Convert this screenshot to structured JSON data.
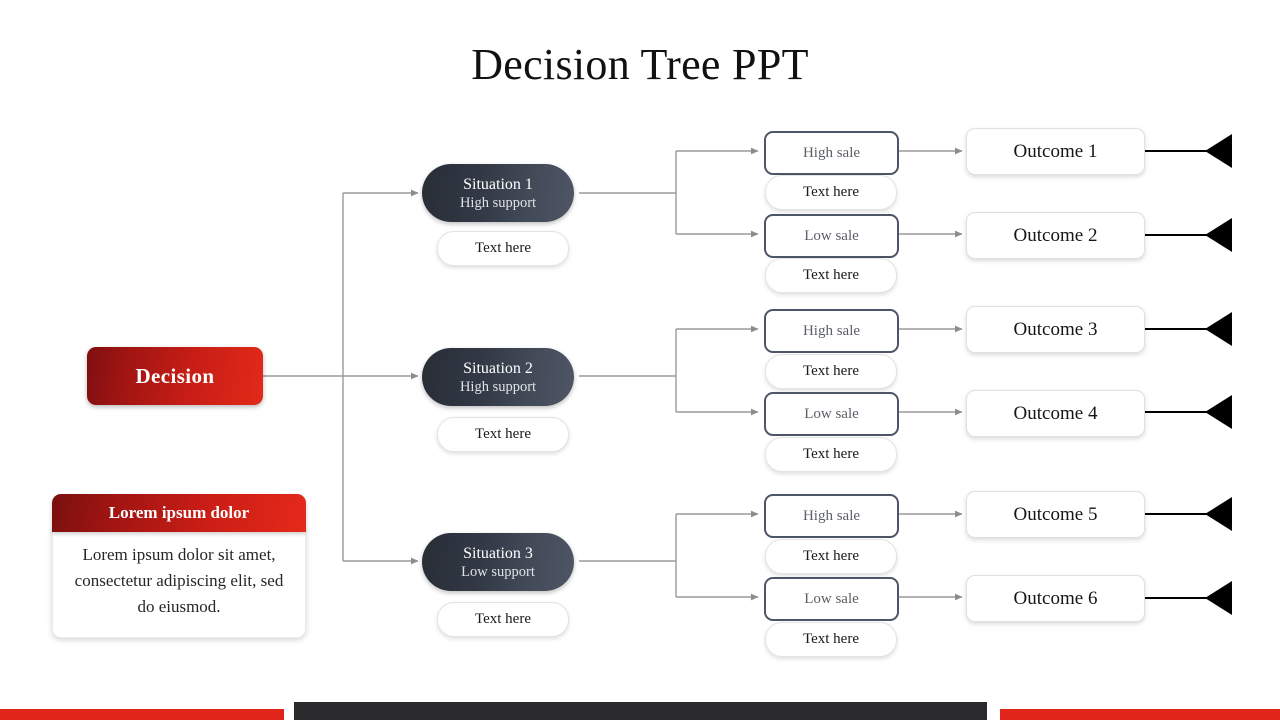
{
  "page": {
    "title": "Decision Tree PPT",
    "background": "#ffffff"
  },
  "colors": {
    "accent_red_dark": "#7e0f11",
    "accent_red_bright": "#e22a18",
    "node_slate_dark": "#282d36",
    "node_slate_light": "#4e5665",
    "bar_red": "#e2251a",
    "bar_dark": "#2a2a2c",
    "wire_gray": "#9a9a9a",
    "sale_border": "#4d5566",
    "arrow_black": "#000000"
  },
  "decision": {
    "label": "Decision"
  },
  "situations": [
    {
      "title": "Situation 1",
      "subtitle": "High support",
      "note": "Text here"
    },
    {
      "title": "Situation 2",
      "subtitle": "High support",
      "note": "Text here"
    },
    {
      "title": "Situation 3",
      "subtitle": "Low support",
      "note": "Text here"
    }
  ],
  "sales": [
    {
      "label": "High sale",
      "note": "Text here"
    },
    {
      "label": "Low sale",
      "note": "Text here"
    },
    {
      "label": "High sale",
      "note": "Text here"
    },
    {
      "label": "Low sale",
      "note": "Text here"
    },
    {
      "label": "High sale",
      "note": "Text here"
    },
    {
      "label": "Low sale",
      "note": "Text here"
    }
  ],
  "outcomes": [
    {
      "label": "Outcome 1"
    },
    {
      "label": "Outcome 2"
    },
    {
      "label": "Outcome 3"
    },
    {
      "label": "Outcome 4"
    },
    {
      "label": "Outcome 5"
    },
    {
      "label": "Outcome 6"
    }
  ],
  "callout": {
    "heading": "Lorem ipsum dolor",
    "body": "Lorem ipsum dolor sit amet, consectetur adipiscing elit, sed do eiusmod."
  },
  "footer_bars": [
    {
      "name": "bar-left",
      "color": "#e2251a"
    },
    {
      "name": "bar-mid",
      "color": "#2a2a2c"
    },
    {
      "name": "bar-right",
      "color": "#e2251a"
    }
  ]
}
